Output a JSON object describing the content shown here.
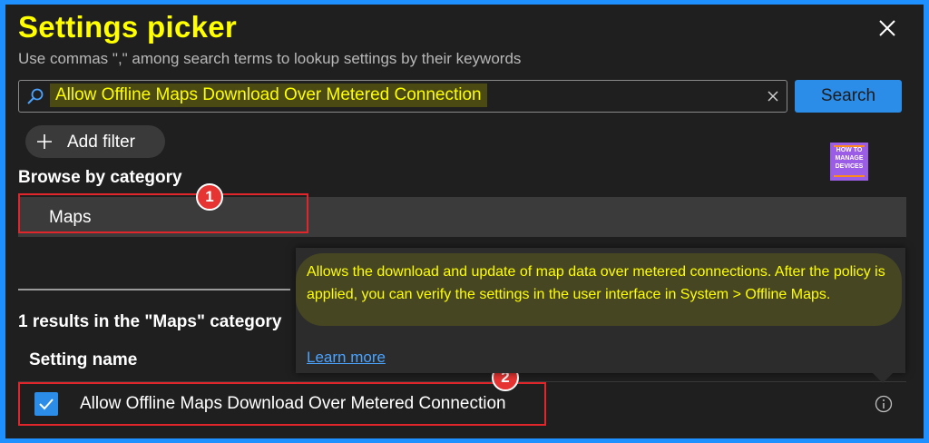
{
  "panel": {
    "title": "Settings picker",
    "subtitle": "Use commas \",\" among search terms to lookup settings by their keywords"
  },
  "search": {
    "value": "Allow Offline Maps Download Over Metered Connection",
    "button_label": "Search"
  },
  "filter": {
    "add_label": "Add filter"
  },
  "browse": {
    "heading": "Browse by category",
    "selected_category": "Maps",
    "marker": "1"
  },
  "logo": {
    "line1": "HOW TO",
    "line2": "MANAGE",
    "line3": "DEVICES"
  },
  "results": {
    "summary": "1 results in the \"Maps\" category",
    "column_header": "Setting name",
    "rows": [
      {
        "label": "Allow Offline Maps Download Over Metered Connection",
        "checked": true
      }
    ],
    "marker": "2"
  },
  "tooltip": {
    "text": "Allows the download and update of map data over metered connections. After the policy is applied, you can verify the settings in the user interface in System > Offline Maps.",
    "link": "Learn more"
  },
  "colors": {
    "accent": "#2b8de8",
    "highlight_text": "#ffff00",
    "annotation_red": "#e0262a",
    "frame": "#1e90ff"
  }
}
